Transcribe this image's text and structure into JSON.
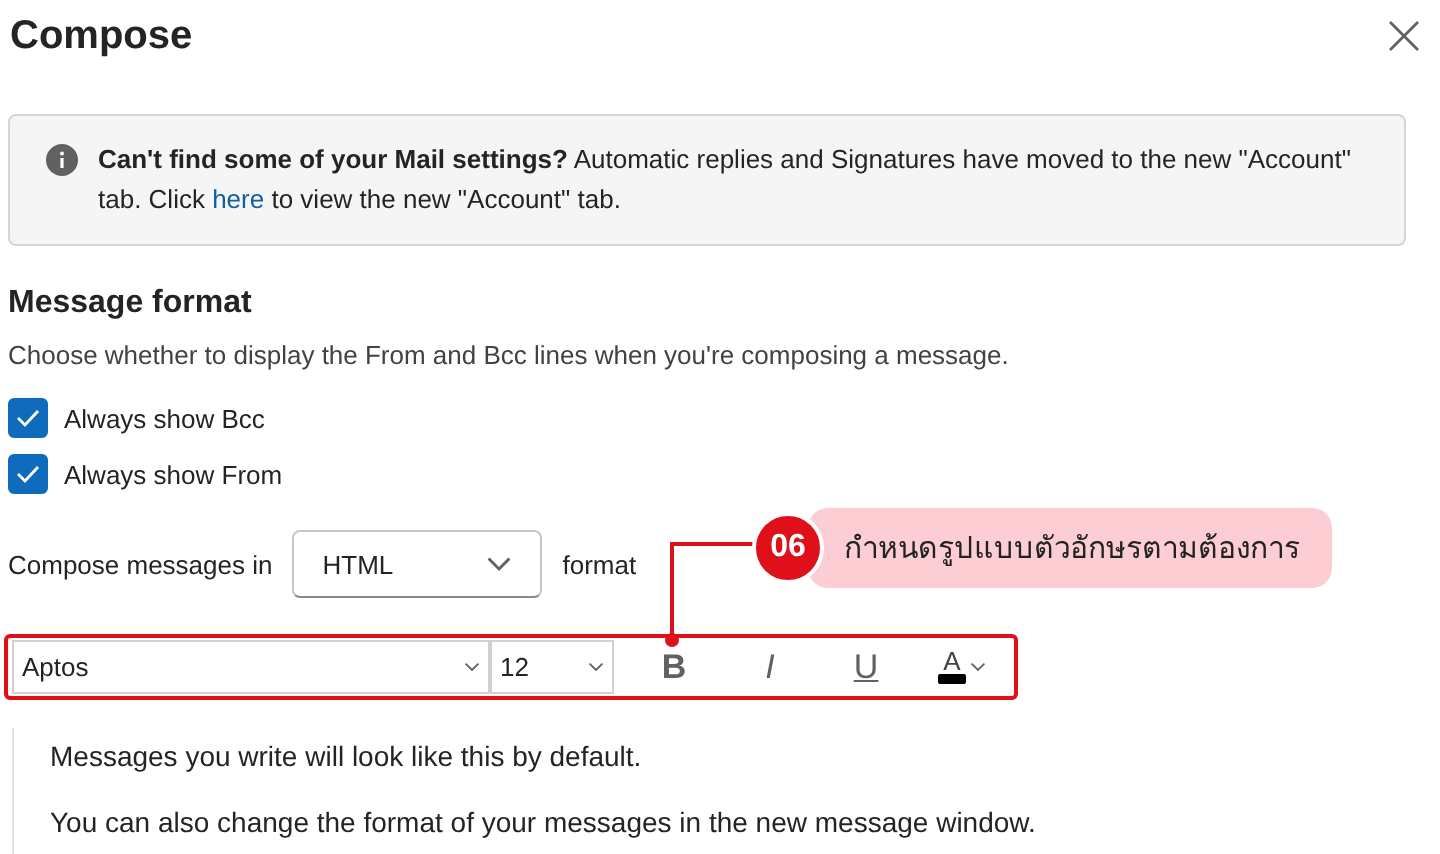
{
  "dialog": {
    "title": "Compose"
  },
  "info_bar": {
    "text_before_link": "**Can't find some of your Mail settings?** Automatic replies and Signatures have moved to the new \"Account\" tab. Click ",
    "link": "here",
    "text_after_link": " to view the new \"Account\" tab."
  },
  "section": {
    "heading": "Message format",
    "description": "Choose whether to display the From and Bcc lines when you're composing a message."
  },
  "checkboxes": [
    {
      "label": "Always show Bcc",
      "checked": true
    },
    {
      "label": "Always show From",
      "checked": true
    }
  ],
  "compose": {
    "label": "Compose messages in",
    "value": "HTML",
    "suffix": "format"
  },
  "toolbar": {
    "font": "Aptos",
    "size": "12",
    "buttons": [
      {
        "kind": "bold",
        "label": "B"
      },
      {
        "kind": "italic",
        "label": "I"
      },
      {
        "kind": "underline",
        "label": "U"
      },
      {
        "kind": "color",
        "label": "A"
      }
    ]
  },
  "preview": [
    "Messages you write will look like this by default.",
    "You can also change the format of your messages in the new message window."
  ],
  "annotation": {
    "number": "06",
    "text": "กำหนดรูปแบบตัวอักษรตามต้องการ"
  }
}
